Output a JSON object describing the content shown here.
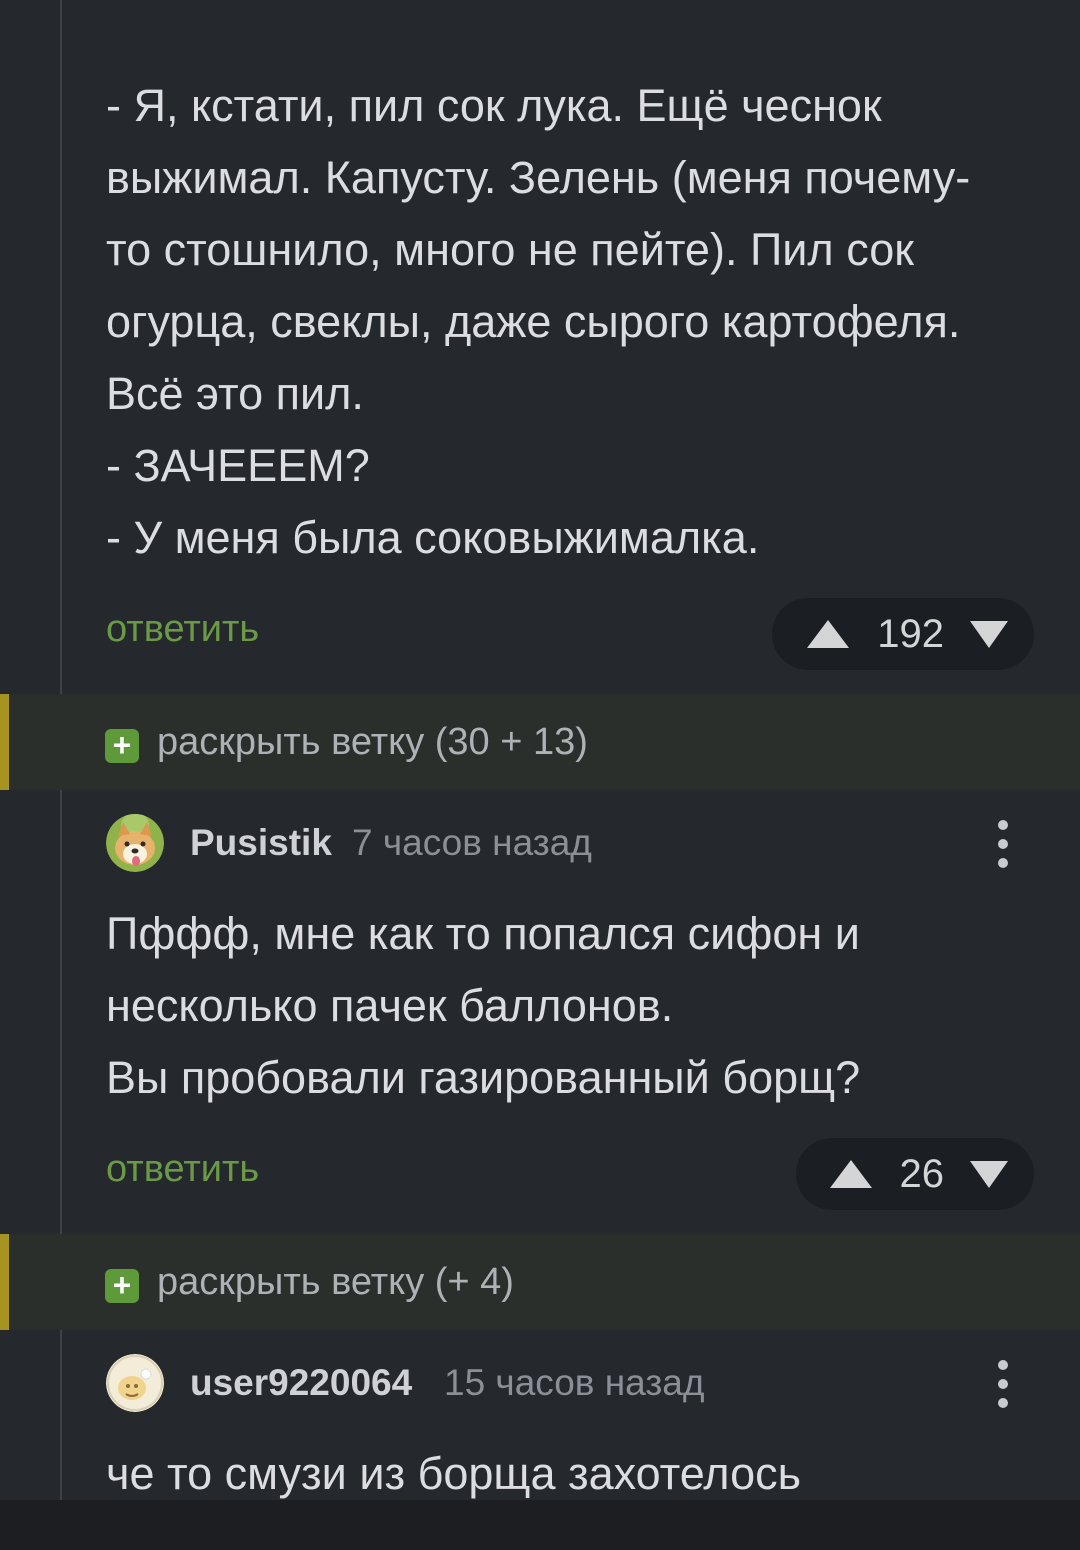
{
  "comments": [
    {
      "text": "- Я, кстати, пил сок лука. Ещё чеснок выжимал. Капусту. Зелень (меня почему-то стошнило, много не пейте). Пил сок огурца, свеклы, даже сырого картофеля. Всё это пил.\n- ЗАЧЕЕЕМ?\n- У меня была соковыжималка.",
      "reply_label": "ответить",
      "rating": "192"
    },
    {
      "author": "Pusistik",
      "time": "7 часов назад",
      "text": "Пффф, мне как то попался сифон и несколько пачек баллонов.\nВы пробовали газированный борщ?",
      "reply_label": "ответить",
      "rating": "26"
    },
    {
      "author": "user9220064",
      "time": "15 часов назад",
      "text": "че то смузи из борща захотелось"
    }
  ],
  "expand_threads": [
    {
      "plus": "+",
      "label": "раскрыть ветку (30 + 13)"
    },
    {
      "plus": "+",
      "label": "раскрыть ветку (+ 4)"
    }
  ],
  "colors": {
    "background": "#25282d",
    "reply_link": "#6a9a46",
    "expand_accent": "#a7931f",
    "expand_plus": "#5f9a3a"
  },
  "icons": {
    "vote_up": "triangle-up",
    "vote_down": "triangle-down",
    "more": "vertical-ellipsis"
  }
}
